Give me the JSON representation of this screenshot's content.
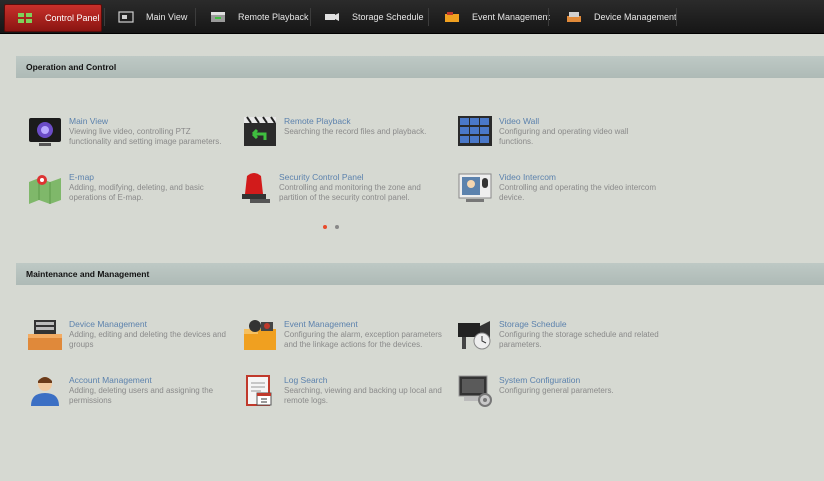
{
  "topbar": {
    "tabs": [
      {
        "label": "Control Panel",
        "active": true
      },
      {
        "label": "Main View"
      },
      {
        "label": "Remote Playback"
      },
      {
        "label": "Storage Schedule"
      },
      {
        "label": "Event Management"
      },
      {
        "label": "Device Management"
      }
    ]
  },
  "sections": {
    "operation": {
      "title": "Operation and Control",
      "items": [
        {
          "title": "Main View",
          "desc": "Viewing live video, controlling PTZ functionality and setting image parameters."
        },
        {
          "title": "Remote Playback",
          "desc": "Searching the record files and playback."
        },
        {
          "title": "Video Wall",
          "desc": "Configuring and operating video wall functions."
        },
        {
          "title": "E-map",
          "desc": "Adding, modifying, deleting, and basic operations of E-map."
        },
        {
          "title": "Security Control Panel",
          "desc": "Controlling and monitoring the zone and partition of the security control panel."
        },
        {
          "title": "Video Intercom",
          "desc": "Controlling and operating the video intercom device."
        }
      ]
    },
    "maintenance": {
      "title": "Maintenance and Management",
      "items": [
        {
          "title": "Device Management",
          "desc": "Adding, editing and deleting the devices and groups"
        },
        {
          "title": "Event Management",
          "desc": "Configuring the alarm, exception parameters and the linkage actions for the devices."
        },
        {
          "title": "Storage Schedule",
          "desc": "Configuring the storage schedule and related parameters."
        },
        {
          "title": "Account Management",
          "desc": "Adding, deleting users and assigning the permissions"
        },
        {
          "title": "Log Search",
          "desc": "Searching, viewing and backing up local and remote logs."
        },
        {
          "title": "System Configuration",
          "desc": "Configuring general parameters."
        }
      ]
    }
  },
  "pager": {
    "current": 1,
    "total": 2
  },
  "colors": {
    "accent": "#c8302a",
    "link": "#5c82ad",
    "section_bar": "#b5c1bd",
    "background": "#d6d9d2"
  },
  "icons": {
    "tabs": [
      "control-panel-icon",
      "main-view-icon",
      "remote-playback-icon",
      "storage-schedule-icon",
      "event-management-icon",
      "device-management-icon"
    ],
    "operation": [
      "main-view-icon",
      "remote-playback-icon",
      "video-wall-icon",
      "e-map-icon",
      "security-control-panel-icon",
      "video-intercom-icon"
    ],
    "maintenance": [
      "device-management-icon",
      "event-management-icon",
      "storage-schedule-icon",
      "account-management-icon",
      "log-search-icon",
      "system-configuration-icon"
    ]
  }
}
